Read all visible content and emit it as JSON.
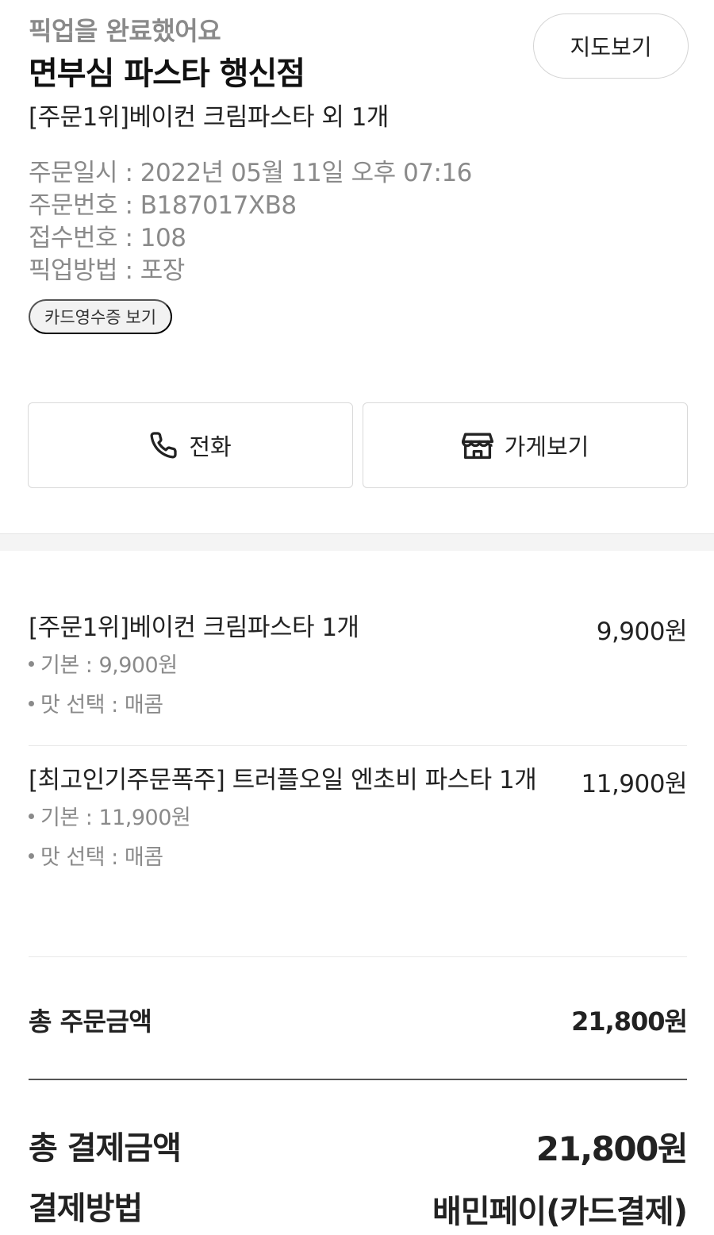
{
  "header": {
    "status": "픽업을 완료했어요",
    "store_name": "면부심 파스타 행신점",
    "order_summary": "[주문1위]베이컨 크림파스타 외 1개",
    "map_button": "지도보기"
  },
  "order_info": [
    {
      "label": "주문일시",
      "value": "2022년 05월 11일 오후 07:16"
    },
    {
      "label": "주문번호",
      "value": "B187017XB8"
    },
    {
      "label": "접수번호",
      "value": "108"
    },
    {
      "label": "픽업방법",
      "value": "포장"
    }
  ],
  "receipt_chip": "카드영수증 보기",
  "actions": {
    "call": {
      "label": "전화",
      "icon": "phone-icon"
    },
    "store": {
      "label": "가게보기",
      "icon": "store-icon"
    }
  },
  "menu_items": [
    {
      "name": "[주문1위]베이컨 크림파스타 1개",
      "price": "9,900원",
      "options": [
        "기본 : 9,900원",
        "맛 선택 : 매콤"
      ]
    },
    {
      "name": "[최고인기주문폭주] 트러플오일 엔초비 파스타 1개",
      "price": "11,900원",
      "options": [
        "기본 : 11,900원",
        "맛 선택 : 매콤"
      ]
    }
  ],
  "totals": {
    "order_total_label": "총 주문금액",
    "order_total_value": "21,800원",
    "payment_total_label": "총 결제금액",
    "payment_total_value": "21,800원",
    "payment_method_label": "결제방법",
    "payment_method_value": "배민페이(카드결제)"
  }
}
